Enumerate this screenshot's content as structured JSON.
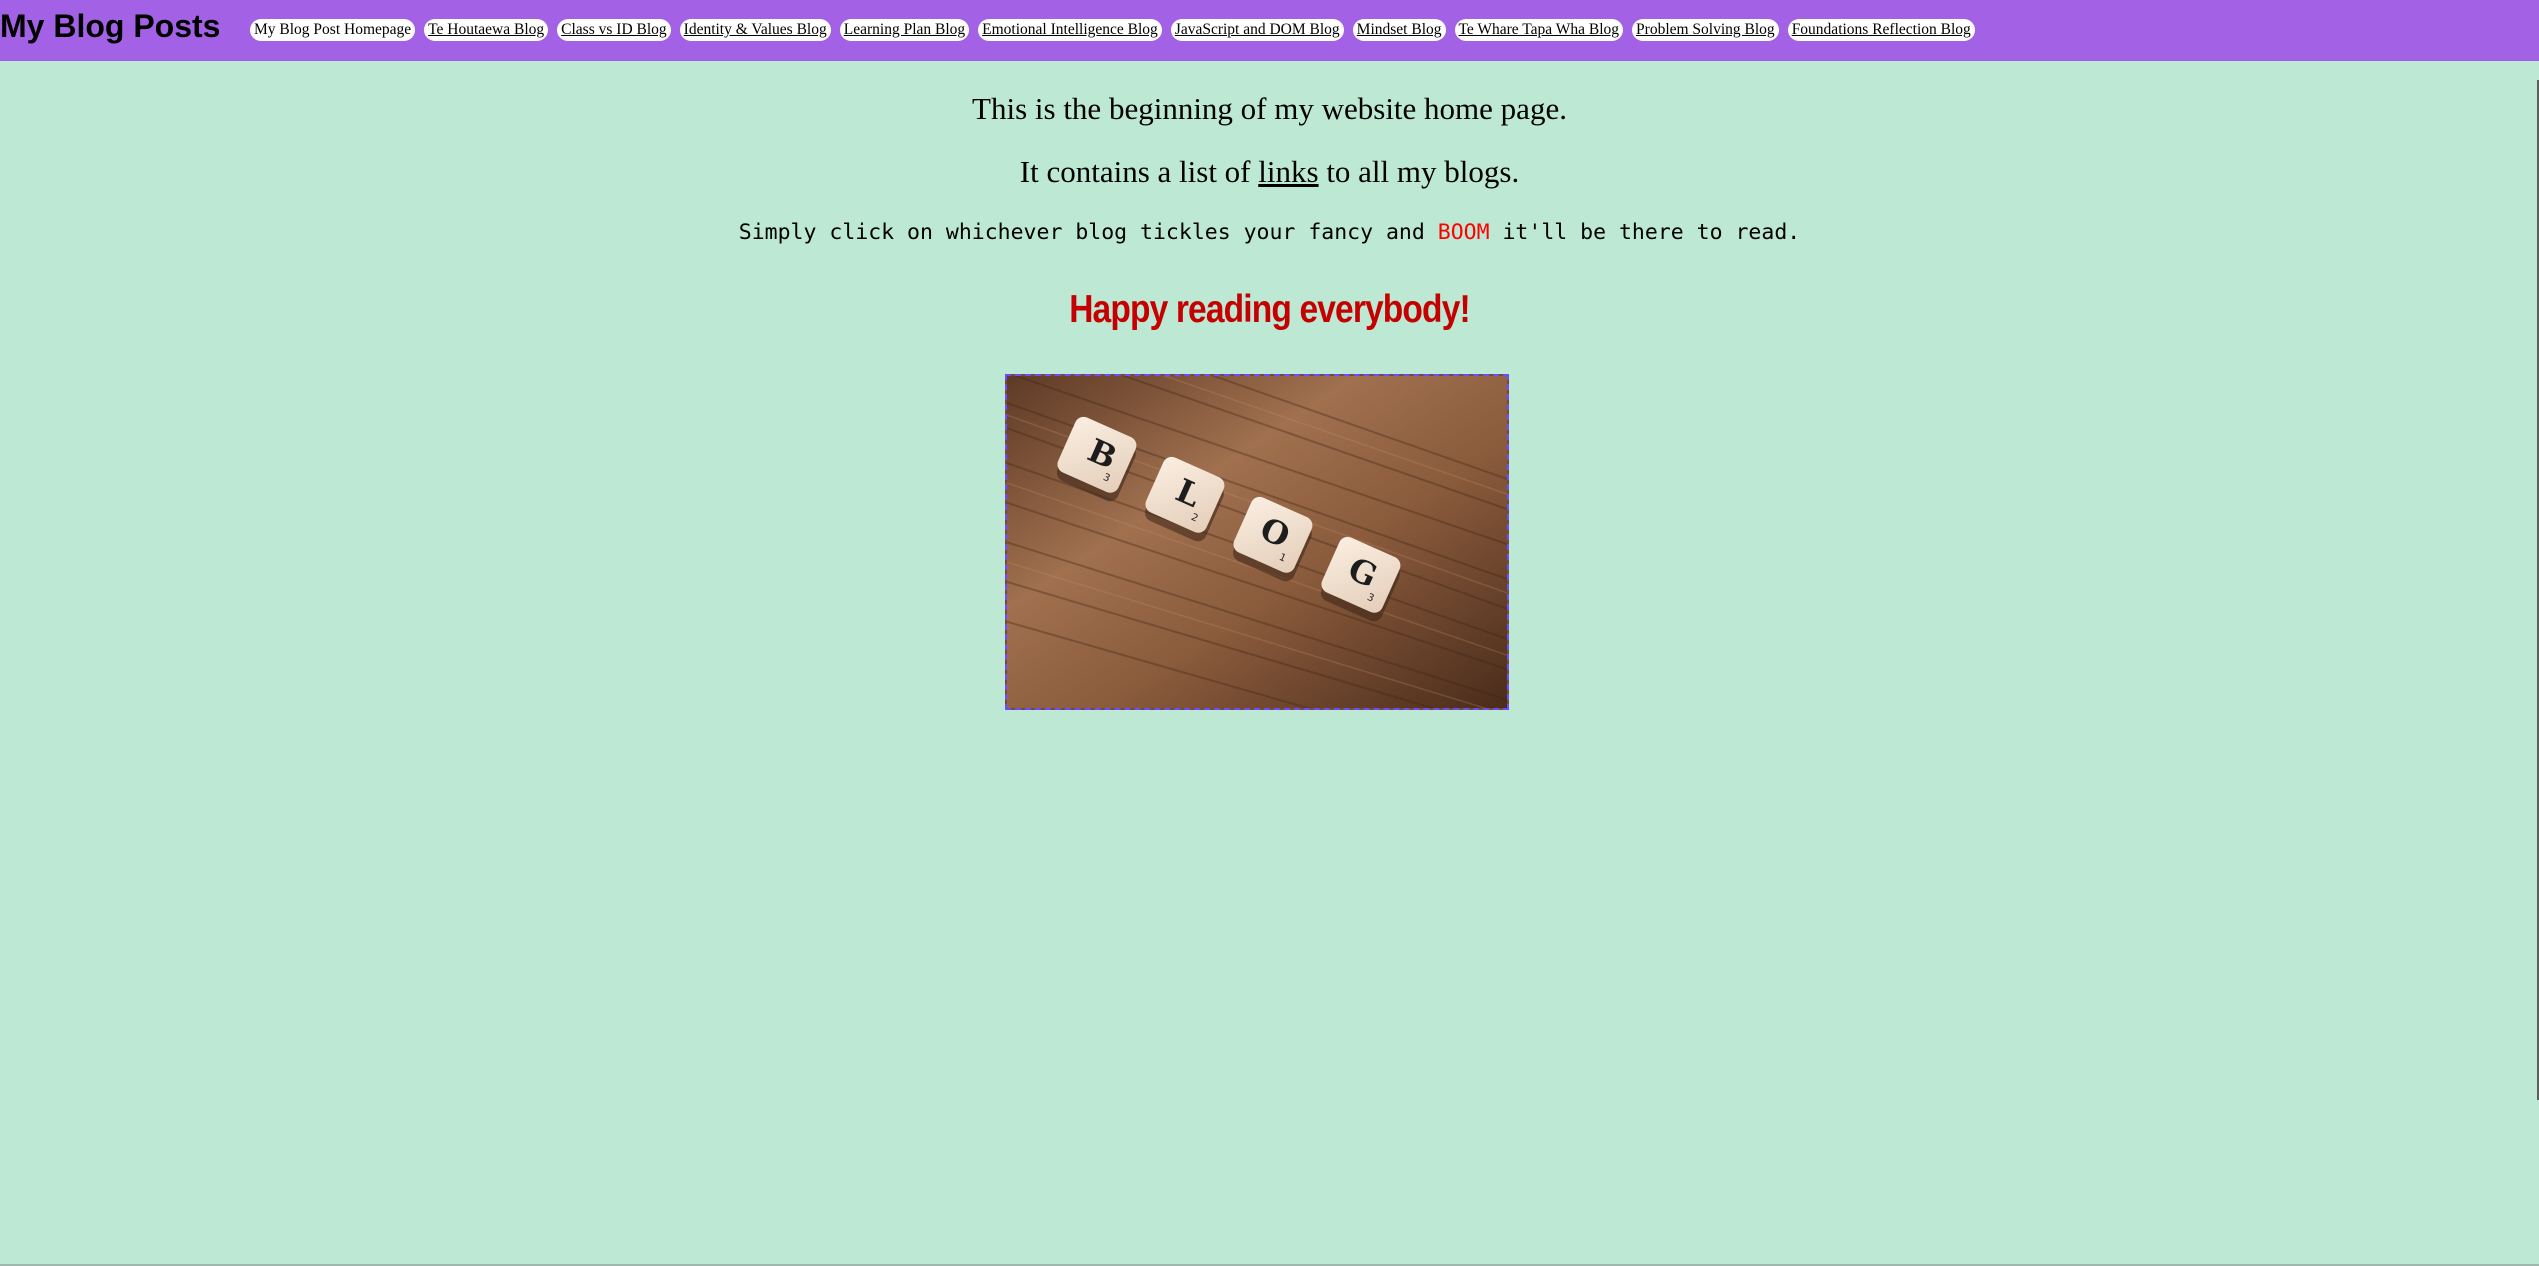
{
  "header": {
    "site_title": "My Blog Posts",
    "nav": [
      {
        "label": "My Blog Post Homepage"
      },
      {
        "label": "Te Houtaewa Blog"
      },
      {
        "label": "Class vs ID Blog"
      },
      {
        "label": "Identity & Values Blog"
      },
      {
        "label": "Learning Plan Blog"
      },
      {
        "label": "Emotional Intelligence Blog"
      },
      {
        "label": "JavaScript and DOM Blog"
      },
      {
        "label": "Mindset Blog"
      },
      {
        "label": "Te Whare Tapa Wha Blog"
      },
      {
        "label": "Problem Solving Blog"
      },
      {
        "label": "Foundations Reflection Blog"
      }
    ]
  },
  "main": {
    "intro": "This is the beginning of my website home page.",
    "list_prefix": "It contains a list of ",
    "list_link": "links",
    "list_suffix": " to all my blogs.",
    "instruction_prefix": "Simply click on whichever blog tickles your fancy and ",
    "instruction_highlight": "BOOM",
    "instruction_suffix": " it'll be there to read.",
    "headline": "Happy reading everybody!",
    "image_tiles": [
      "B",
      "L",
      "O",
      "G"
    ],
    "image_tile_points": [
      "3",
      "2",
      "1",
      "3"
    ]
  },
  "colors": {
    "page_background": "#bde8d4",
    "header_background": "#a362e6",
    "headline": "#c40000",
    "boom": "#ff0000",
    "image_border": "#6a4cff"
  }
}
